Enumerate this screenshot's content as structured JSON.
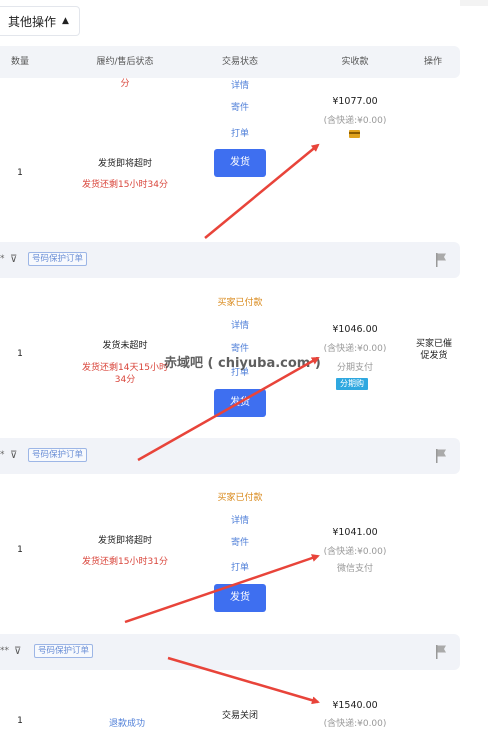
{
  "toolbar": {
    "other_actions": "其他操作"
  },
  "table_headers": [
    "数量",
    "履约/售后状态",
    "交易状态",
    "实收款",
    "操作"
  ],
  "row0_partial": {
    "countdown_tail": "分",
    "detail": "详情",
    "mail": "寄件",
    "print": "打单"
  },
  "row1": {
    "qty": "1",
    "status": "发货即将超时",
    "countdown": "发货还剩15小时34分",
    "ship": "发货",
    "amount": "¥1077.00",
    "shipping": "(含快递:¥0.00)"
  },
  "sep1": {
    "star": "*",
    "tag": "号码保护订单"
  },
  "row2": {
    "trade_status": "买家已付款",
    "detail": "详情",
    "mail": "寄件",
    "print": "打单",
    "ship": "发货",
    "qty": "1",
    "status": "发货未超时",
    "countdown": "发货还剩14天15小时34分",
    "amount": "¥1046.00",
    "shipping": "(含快递:¥0.00)",
    "pay_method": "分期支付",
    "pay_badge": "分期购",
    "op_note": "买家已催促发货"
  },
  "watermark": "赤域吧 ( chiyuba.com )",
  "sep2": {
    "star": "*",
    "tag": "号码保护订单"
  },
  "row3": {
    "trade_status": "买家已付款",
    "detail": "详情",
    "mail": "寄件",
    "print": "打单",
    "ship": "发货",
    "qty": "1",
    "status": "发货即将超时",
    "countdown": "发货还剩15小时31分",
    "amount": "¥1041.00",
    "shipping": "(含快递:¥0.00)",
    "pay_method": "微信支付"
  },
  "sep3": {
    "star": "**",
    "tag": "号码保护订单"
  },
  "row4": {
    "qty": "1",
    "trade_status": "交易关闭",
    "refund": "退款成功",
    "amount": "¥1540.00",
    "shipping": "(含快递:¥0.00)"
  },
  "colors": {
    "primary": "#3e6ff0",
    "alert": "#d9453b",
    "arrow": "#e8443a",
    "tag": "#6b8fd6"
  }
}
